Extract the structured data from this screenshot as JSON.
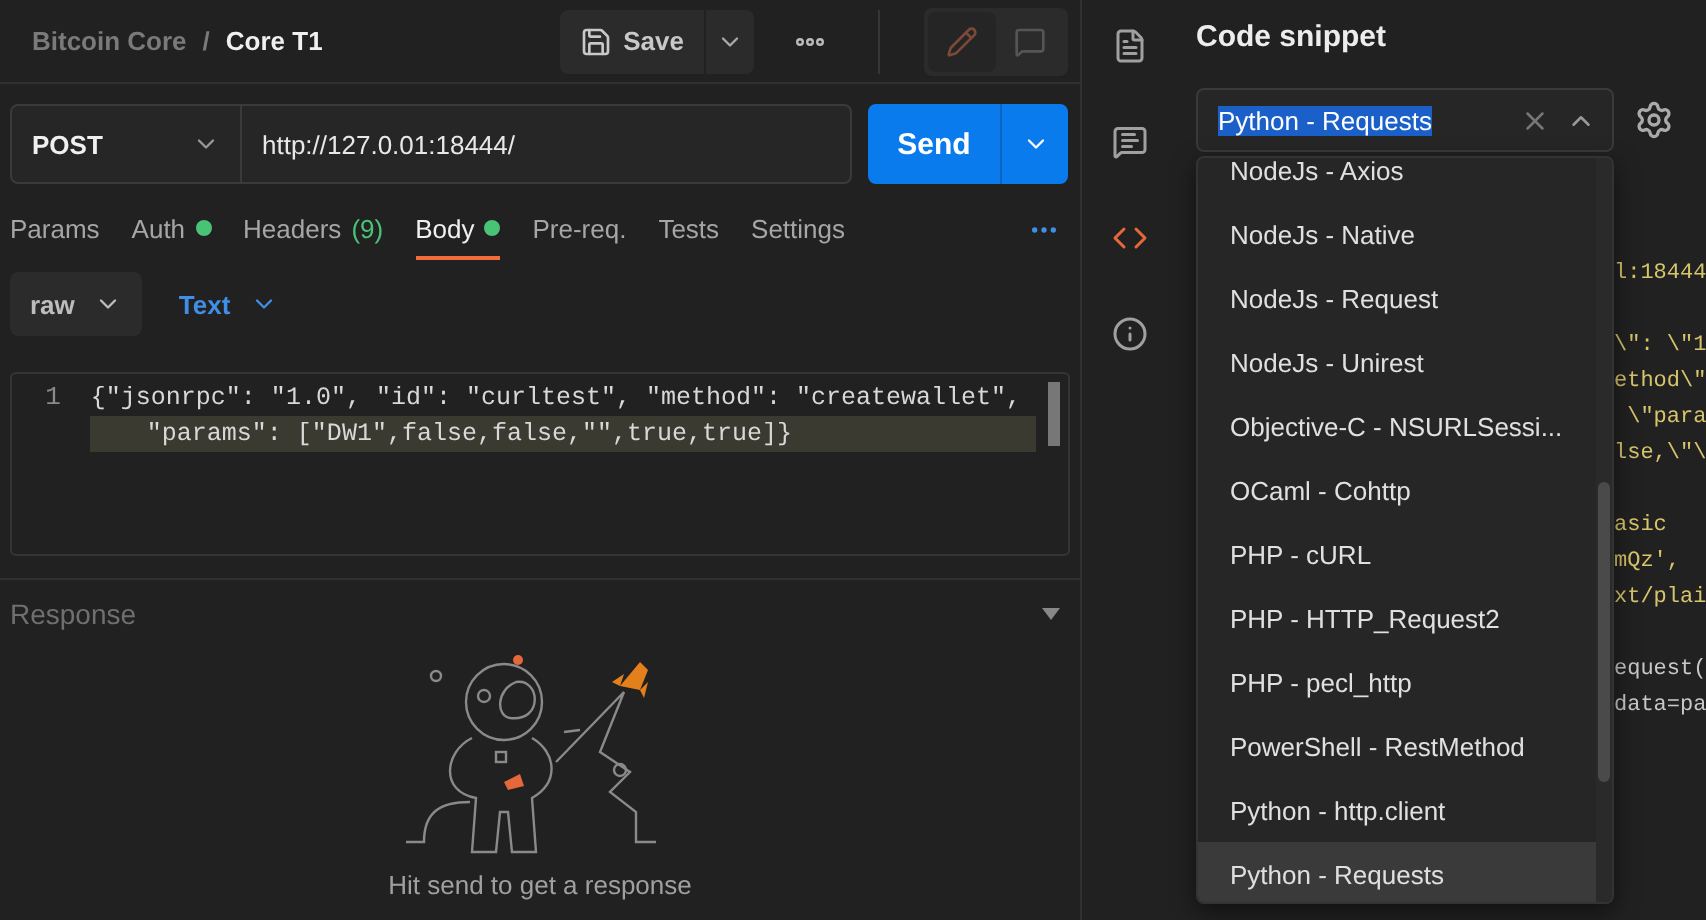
{
  "breadcrumb": {
    "parent": "Bitcoin Core",
    "separator": "/",
    "current": "Core T1"
  },
  "toolbar": {
    "save": "Save",
    "edit_mode": true
  },
  "request": {
    "method": "POST",
    "url": "http://127.0.01:18444/",
    "send": "Send"
  },
  "tabs": [
    {
      "label": "Params",
      "selected": false,
      "dot": false
    },
    {
      "label": "Auth",
      "selected": false,
      "dot": true
    },
    {
      "label": "Headers",
      "selected": false,
      "dot": false,
      "count": "(9)"
    },
    {
      "label": "Body",
      "selected": true,
      "dot": true
    },
    {
      "label": "Pre-req.",
      "selected": false,
      "dot": false
    },
    {
      "label": "Tests",
      "selected": false,
      "dot": false
    },
    {
      "label": "Settings",
      "selected": false,
      "dot": false
    }
  ],
  "body_mode": {
    "type": "raw",
    "format": "Text"
  },
  "editor": {
    "line_number": "1",
    "lines": [
      {
        "text": "{\"jsonrpc\": \"1.0\", \"id\": \"curltest\", \"method\": \"createwallet\", ",
        "active": false
      },
      {
        "text": "\"params\": [\"DW1\",false,false,\"\",true,true]}",
        "active": true
      }
    ]
  },
  "response": {
    "title": "Response",
    "empty_message": "Hit send to get a response"
  },
  "sidebar_rail": [
    {
      "kind": "document",
      "selected": false
    },
    {
      "kind": "comments",
      "selected": false
    },
    {
      "kind": "code",
      "selected": true
    },
    {
      "kind": "info",
      "selected": false
    }
  ],
  "code_snippet": {
    "title": "Code snippet",
    "language": "Python - Requests",
    "options": [
      {
        "label": "NodeJs - Axios",
        "selected": false
      },
      {
        "label": "NodeJs - Native",
        "selected": false
      },
      {
        "label": "NodeJs - Request",
        "selected": false
      },
      {
        "label": "NodeJs - Unirest",
        "selected": false
      },
      {
        "label": "Objective-C - NSURLSessi...",
        "selected": false
      },
      {
        "label": "OCaml - Cohttp",
        "selected": false
      },
      {
        "label": "PHP - cURL",
        "selected": false
      },
      {
        "label": "PHP - HTTP_Request2",
        "selected": false
      },
      {
        "label": "PHP - pecl_http",
        "selected": false
      },
      {
        "label": "PowerShell - RestMethod",
        "selected": false
      },
      {
        "label": "Python - http.client",
        "selected": false
      },
      {
        "label": "Python - Requests",
        "selected": true
      }
    ],
    "code_blocks": [
      [
        {
          "text": "l:18444",
          "kind": "string"
        }
      ],
      [
        {
          "text": "\\\": \\\"1",
          "kind": "string"
        },
        {
          "text": "ethod\\\"",
          "kind": "string"
        },
        {
          "text": " \\\"para",
          "kind": "string"
        },
        {
          "text": "lse,\\\"\\",
          "kind": "string"
        }
      ],
      [
        {
          "text": "asic",
          "kind": "string"
        },
        {
          "text": "mQz',",
          "kind": "string"
        },
        {
          "text": "xt/plai",
          "kind": "string"
        }
      ],
      [
        {
          "text": "equest(",
          "kind": "plain"
        },
        {
          "text": "data=pa",
          "kind": "plain"
        }
      ]
    ]
  }
}
